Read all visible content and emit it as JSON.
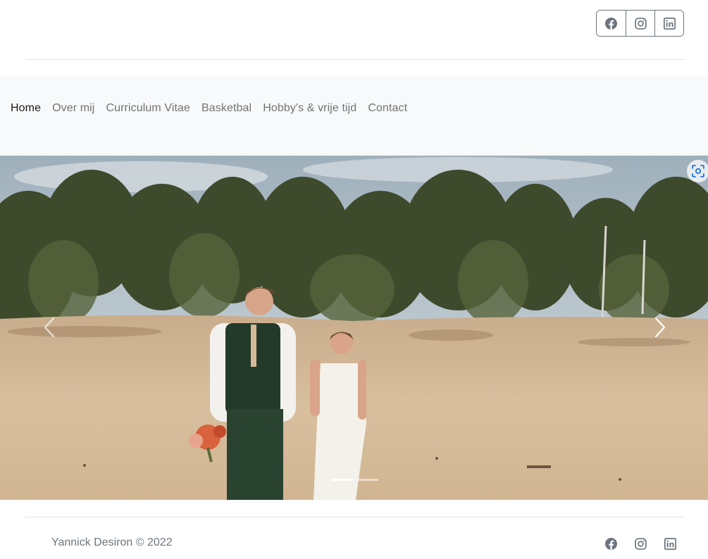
{
  "header": {
    "social_buttons": [
      {
        "icon": "facebook-icon"
      },
      {
        "icon": "instagram-icon"
      },
      {
        "icon": "linkedin-icon"
      }
    ]
  },
  "nav": {
    "items": [
      {
        "label": "Home",
        "active": true
      },
      {
        "label": "Over mij"
      },
      {
        "label": "Curriculum Vitae"
      },
      {
        "label": "Basketbal"
      },
      {
        "label": "Hobby's & vrije tijd"
      },
      {
        "label": "Contact"
      }
    ]
  },
  "carousel": {
    "slide_count": 2,
    "active_slide": 1,
    "prev_icon": "chevron-left-icon",
    "next_icon": "chevron-right-icon",
    "overlay_icon": "visual-search-icon"
  },
  "footer": {
    "copyright": "Yannick Desiron © 2022",
    "social_icons": [
      "facebook-icon",
      "instagram-icon",
      "linkedin-icon"
    ]
  },
  "colors": {
    "nav_bg": "#f8f9fa",
    "muted_text": "#6c757d",
    "border": "#dee2e6"
  }
}
